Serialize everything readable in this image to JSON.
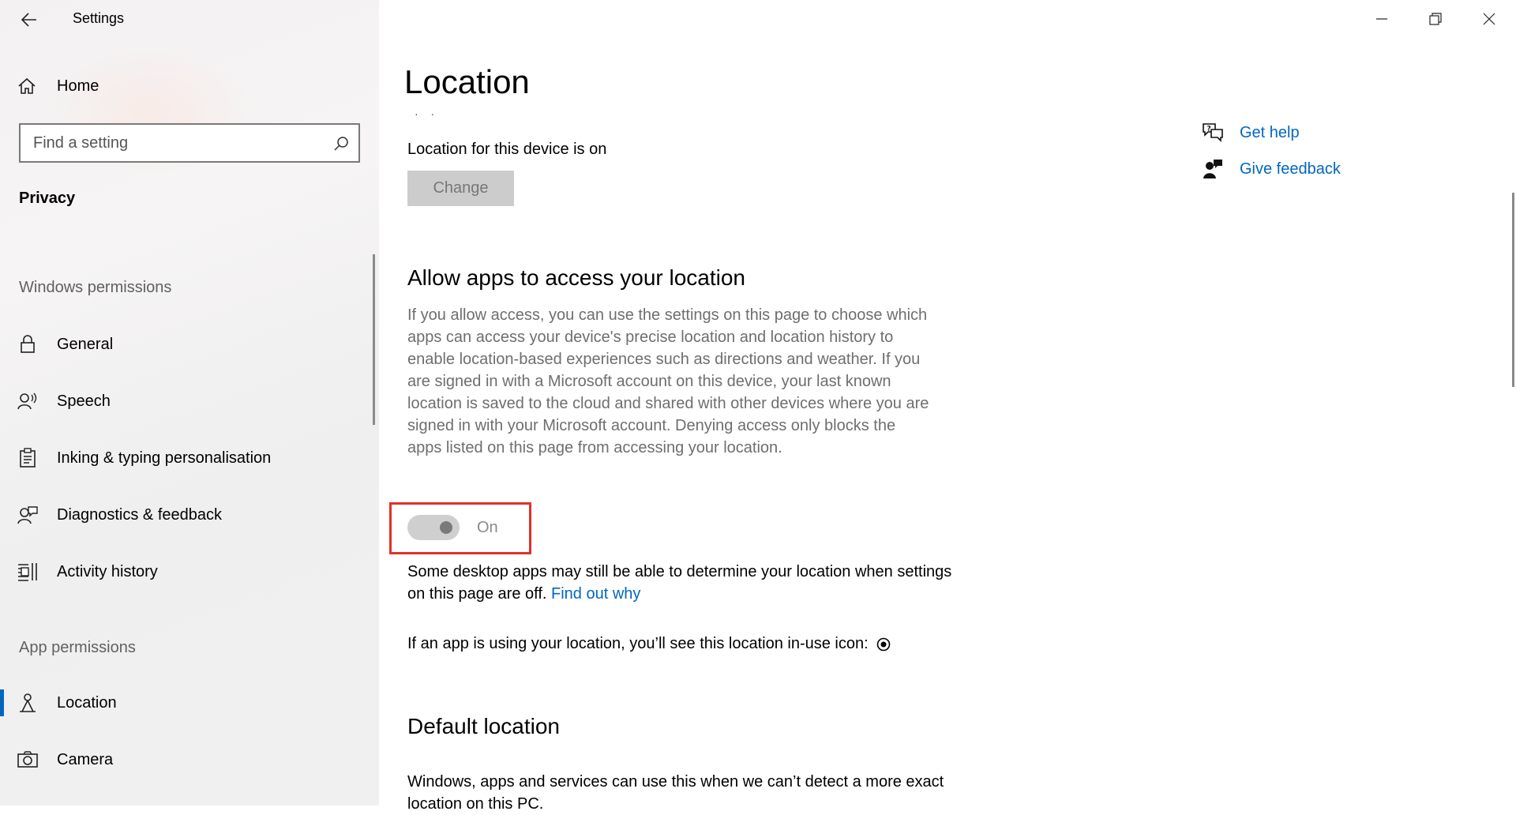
{
  "window": {
    "title": "Settings",
    "controls": [
      "minimize",
      "restore",
      "close"
    ]
  },
  "sidebar": {
    "home_label": "Home",
    "search": {
      "placeholder": "Find a setting",
      "value": ""
    },
    "section_title": "Privacy",
    "groups": [
      {
        "label": "Windows permissions",
        "items": [
          {
            "label": "General",
            "icon": "lock-icon"
          },
          {
            "label": "Speech",
            "icon": "speech-icon"
          },
          {
            "label": "Inking & typing personalisation",
            "icon": "clipboard-icon"
          },
          {
            "label": "Diagnostics & feedback",
            "icon": "diagnostics-icon"
          },
          {
            "label": "Activity history",
            "icon": "activity-icon"
          }
        ]
      },
      {
        "label": "App permissions",
        "items": [
          {
            "label": "Location",
            "icon": "location-icon",
            "active": true
          },
          {
            "label": "Camera",
            "icon": "camera-icon"
          }
        ]
      }
    ]
  },
  "main": {
    "page_title": "Location",
    "truncated_text": "· ·",
    "device_status": "Location for this device is on",
    "change_button": "Change",
    "allow_section": {
      "heading": "Allow apps to access your location",
      "description": "If you allow access, you can use the settings on this page to choose which apps can access your device's precise location and location history to enable location-based experiences such as directions and weather. If you are signed in with a Microsoft account on this device, your last known location is saved to the cloud and shared with other devices where you are signed in with your Microsoft account. Denying access only blocks the apps listed on this page from accessing your location.",
      "toggle_state_label": "On",
      "toggle_on": true,
      "toggle_disabled": true
    },
    "desktop_note": {
      "text": "Some desktop apps may still be able to determine your location when settings on this page are off.",
      "link": "Find out why"
    },
    "inuse_note": "If an app is using your location, you’ll see this location in-use icon:",
    "default_section": {
      "heading": "Default location",
      "description": "Windows, apps and services can use this when we can’t detect a more exact location on this PC."
    }
  },
  "help": {
    "get_help": "Get help",
    "give_feedback": "Give feedback"
  },
  "colors": {
    "accent": "#0067c0",
    "highlight": "#e0322a",
    "toggle_disabled": "#cfcfcf"
  }
}
